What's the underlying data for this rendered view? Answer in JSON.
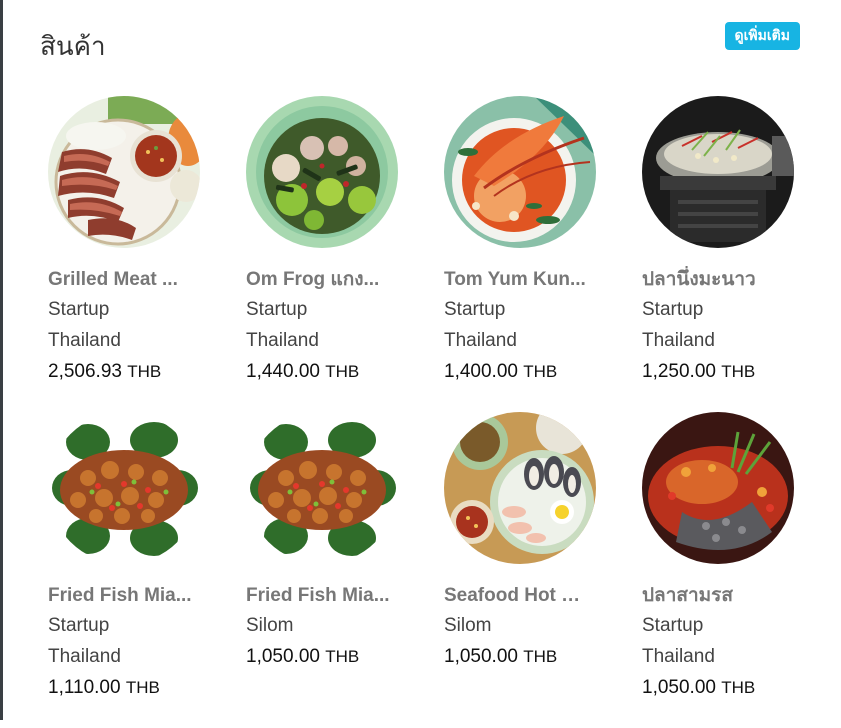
{
  "section": {
    "title": "สินค้า",
    "see_more_label": "ดูเพิ่มเติม",
    "see_more_color": "#17b4e3"
  },
  "products": [
    {
      "name": "Grilled Meat ...",
      "line1": "Startup",
      "line2": "Thailand",
      "price": "2,506.93",
      "currency": "THB",
      "image": "grilled-meat-dish"
    },
    {
      "name": "Om Frog แกง...",
      "line1": "Startup",
      "line2": "Thailand",
      "price": "1,440.00",
      "currency": "THB",
      "image": "om-frog-curry-dish"
    },
    {
      "name": "Tom Yum Kun...",
      "line1": "Startup",
      "line2": "Thailand",
      "price": "1,400.00",
      "currency": "THB",
      "image": "tom-yum-kung-dish"
    },
    {
      "name": "ปลานึ่งมะนาว",
      "line1": "Startup",
      "line2": "Thailand",
      "price": "1,250.00",
      "currency": "THB",
      "image": "steamed-fish-lime-dish"
    },
    {
      "name": "Fried Fish Mia...",
      "line1": "Startup",
      "line2": "Thailand",
      "price": "1,110.00",
      "currency": "THB",
      "image": "fried-fish-miang-dish"
    },
    {
      "name": "Fried Fish Mia...",
      "line1": "Silom",
      "line2": "",
      "price": "1,050.00",
      "currency": "THB",
      "image": "fried-fish-miang-dish"
    },
    {
      "name": "Seafood Hot S...",
      "line1": "Silom",
      "line2": "",
      "price": "1,050.00",
      "currency": "THB",
      "image": "seafood-hot-spicy-dish"
    },
    {
      "name": "ปลาสามรส",
      "line1": "Startup",
      "line2": "Thailand",
      "price": "1,050.00",
      "currency": "THB",
      "image": "three-flavor-fish-dish"
    }
  ]
}
